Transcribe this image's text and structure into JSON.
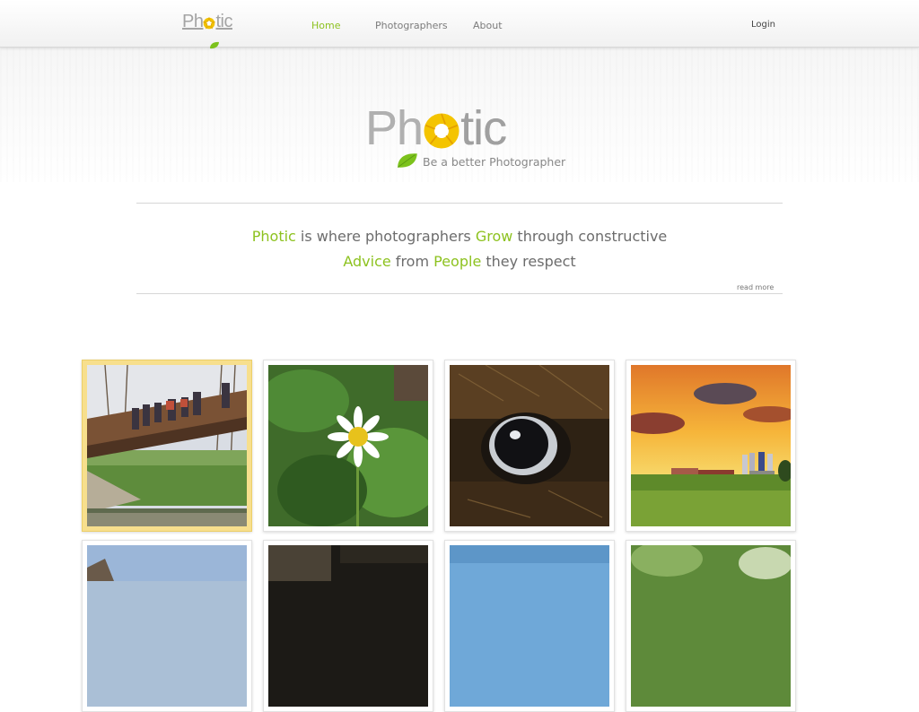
{
  "header": {
    "logo_text": "Photic",
    "nav": [
      "Home",
      "Photographers",
      "About"
    ],
    "active_nav": "Home",
    "login_label": "Login"
  },
  "hero": {
    "logo_text": "Photic",
    "tagline": "Be a better Photographer"
  },
  "mission": {
    "line1": [
      {
        "text": "Photic",
        "highlight": true
      },
      {
        "text": " is where photographers ",
        "highlight": false
      },
      {
        "text": "Grow",
        "highlight": true
      },
      {
        "text": " through constructive",
        "highlight": false
      }
    ],
    "line2": [
      {
        "text": "Advice",
        "highlight": true
      },
      {
        "text": " from ",
        "highlight": false
      },
      {
        "text": "People",
        "highlight": true
      },
      {
        "text": " they respect",
        "highlight": false
      }
    ],
    "read_more": "read more"
  },
  "photos": [
    {
      "subject": "people on wooden bridge over creek",
      "selected": true
    },
    {
      "subject": "white daisy flower in green leaves",
      "selected": false
    },
    {
      "subject": "close-up of dog eye",
      "selected": false
    },
    {
      "subject": "sunset over farm with silos",
      "selected": false
    },
    {
      "subject": "building under blue sky",
      "selected": false
    },
    {
      "subject": "dark wooden boards",
      "selected": false
    },
    {
      "subject": "blue sky",
      "selected": false
    },
    {
      "subject": "green foliage",
      "selected": false
    }
  ],
  "colors": {
    "accent": "#8dc21f",
    "text": "#6c6c6c",
    "logo_gray": "#a8a8a8",
    "selected_frame": "#f7df8d"
  }
}
